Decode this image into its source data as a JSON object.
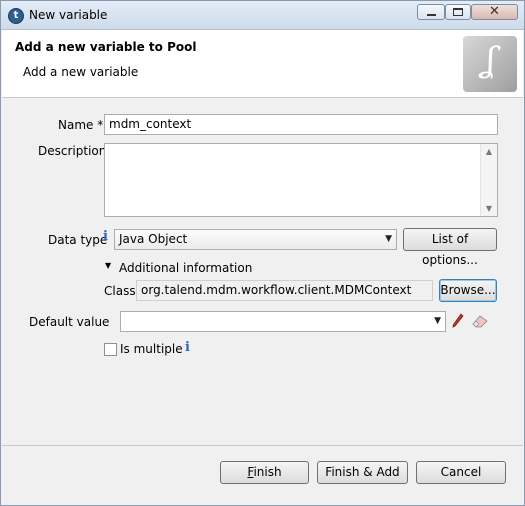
{
  "window": {
    "title": "New variable"
  },
  "banner": {
    "title": "Add a new variable to Pool",
    "subtitle": "Add a new variable"
  },
  "form": {
    "name_label": "Name",
    "name_required": "*",
    "name_value": "mdm_context",
    "description_label": "Description",
    "description_value": "",
    "datatype_label": "Data type",
    "datatype_value": "Java Object",
    "list_options_label": "List of options...",
    "additional_info_label": "Additional information",
    "class_label": "Class",
    "class_value": "org.talend.mdm.workflow.client.MDMContext",
    "browse_label": "Browse...",
    "default_value_label": "Default value",
    "default_value_value": "",
    "is_multiple_label": "Is multiple",
    "is_multiple_checked": false
  },
  "footer": {
    "finish_mnemonic": "F",
    "finish_rest": "inish",
    "finish_add_label": "Finish & Add",
    "cancel_label": "Cancel"
  },
  "icons": {
    "app": "talend-icon",
    "info": "info-icon",
    "edit": "pencil-icon",
    "clear": "eraser-icon",
    "expand": "triangle-down-icon",
    "logo": "bonita-logo"
  },
  "colors": {
    "accent": "#2f66b7",
    "titlebar": "#cfdbea",
    "logo": "#b0b0b0"
  }
}
